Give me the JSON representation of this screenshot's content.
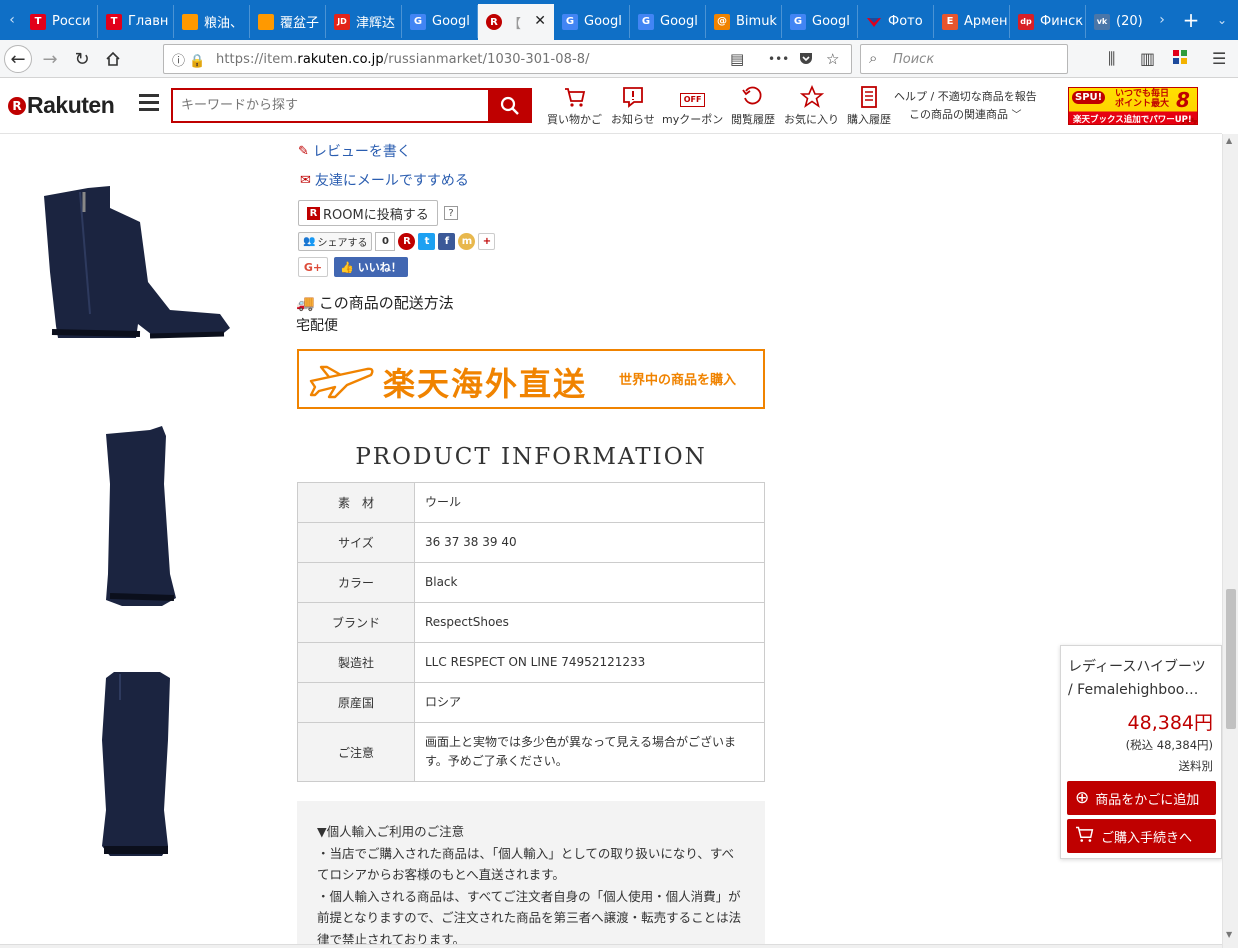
{
  "browser": {
    "tabs": [
      {
        "label": "Росси",
        "icon_text": "T",
        "icon_color": "#e2001a"
      },
      {
        "label": "Главн",
        "icon_text": "T",
        "icon_color": "#e2001a"
      },
      {
        "label": "粮油、",
        "icon_text": "",
        "icon_color": "#ff9900"
      },
      {
        "label": "覆盆子",
        "icon_text": "",
        "icon_color": "#ff9900"
      },
      {
        "label": "津辉达",
        "icon_text": "JD",
        "icon_color": "#e2231a"
      },
      {
        "label": "Googl",
        "icon_text": "G",
        "icon_color": "#4285f4"
      },
      {
        "label": "【",
        "icon_text": "R",
        "icon_color": "#bf0000"
      },
      {
        "label": "Googl",
        "icon_text": "G",
        "icon_color": "#4285f4"
      },
      {
        "label": "Googl",
        "icon_text": "G",
        "icon_color": "#4285f4"
      },
      {
        "label": "Bimuk",
        "icon_text": "@",
        "icon_color": "#f08300"
      },
      {
        "label": "Googl",
        "icon_text": "G",
        "icon_color": "#4285f4"
      },
      {
        "label": "Фото",
        "icon_text": "",
        "icon_color": "#e2001a"
      },
      {
        "label": "Армен",
        "icon_text": "E",
        "icon_color": "#e8552d"
      },
      {
        "label": "Финск",
        "icon_text": "dp",
        "icon_color": "#d81f26"
      },
      {
        "label": "(20) H",
        "icon_text": "vk",
        "icon_color": "#4a76a8"
      }
    ],
    "active_tab_close": "✕",
    "new_tab": "+",
    "url_prefix": "https://item.",
    "url_domain": "rakuten.co.jp",
    "url_path": "/russianmarket/1030-301-08-8/",
    "search_placeholder": "Поиск",
    "more_dots": "•••"
  },
  "site_header": {
    "logo": "Rakuten",
    "logo_mark": "R",
    "search_placeholder": "キーワードから探す",
    "nav": [
      {
        "label": "買い物かご",
        "icon": "cart-icon"
      },
      {
        "label": "お知らせ",
        "icon": "notification-icon"
      },
      {
        "label": "myクーポン",
        "icon": "coupon-icon"
      },
      {
        "label": "閲覧履歴",
        "icon": "history-icon"
      },
      {
        "label": "お気に入り",
        "icon": "star-icon"
      },
      {
        "label": "購入履歴",
        "icon": "receipt-icon"
      }
    ],
    "coupon_badge": "OFF",
    "help_link": "ヘルプ / 不適切な商品を報告",
    "related_link": "この商品の関連商品",
    "spu": {
      "badge": "SPU!",
      "line1": "いつでも毎日",
      "line2": "ポイント最大",
      "multiplier": "8倍",
      "footer": "楽天ブックス追加でパワーUP!"
    }
  },
  "actions": {
    "write_review": "レビューを書く",
    "recommend_email": "友達にメールですすめる",
    "room_post": "ROOMに投稿する",
    "room_mark": "R",
    "help_q": "?",
    "share": "シェアする",
    "share_count": "0",
    "gplus": "G+",
    "like": "いいね！"
  },
  "shipping": {
    "title": "この商品の配送方法",
    "method": "宅配便"
  },
  "banner": {
    "main": "楽天海外直送",
    "sub": "世界中の商品を購入"
  },
  "product_info": {
    "title": "PRODUCT INFORMATION",
    "rows": [
      {
        "key": "素　材",
        "value": "ウール"
      },
      {
        "key": "サイズ",
        "value": "36 37 38 39 40"
      },
      {
        "key": "カラー",
        "value": "Black"
      },
      {
        "key": "ブランド",
        "value": "RespectShoes"
      },
      {
        "key": "製造社",
        "value": "LLC RESPECT ON LINE 74952121233"
      },
      {
        "key": "原産国",
        "value": "ロシア"
      },
      {
        "key": "ご注意",
        "value": "画面上と実物では多少色が異なって見える場合がございます。予めご了承ください。"
      }
    ]
  },
  "notice": {
    "heading": "▼個人輸入ご利用のご注意",
    "p1": "・当店でご購入された商品は、「個人輸入」としての取り扱いになり、すべてロシアからお客様のもとへ直送されます。",
    "p2": "・個人輸入される商品は、すべてご注文者自身の「個人使用・個人消費」が前提となりますので、ご注文された商品を第三者へ譲渡・転売することは法律で禁止されております。"
  },
  "cart_box": {
    "name_line1": "レディースハイブーツ",
    "name_line2": "/ Femalehighboo…",
    "price": "48,384円",
    "tax": "(税込 48,384円)",
    "shipping": "送料別",
    "add_to_cart": "商品をかごに追加",
    "checkout": "ご購入手続きへ"
  },
  "colors": {
    "brand_red": "#bf0000",
    "link_blue": "#2a5db0",
    "direct_orange": "#f08300",
    "tab_blue": "#0f6fc6"
  }
}
